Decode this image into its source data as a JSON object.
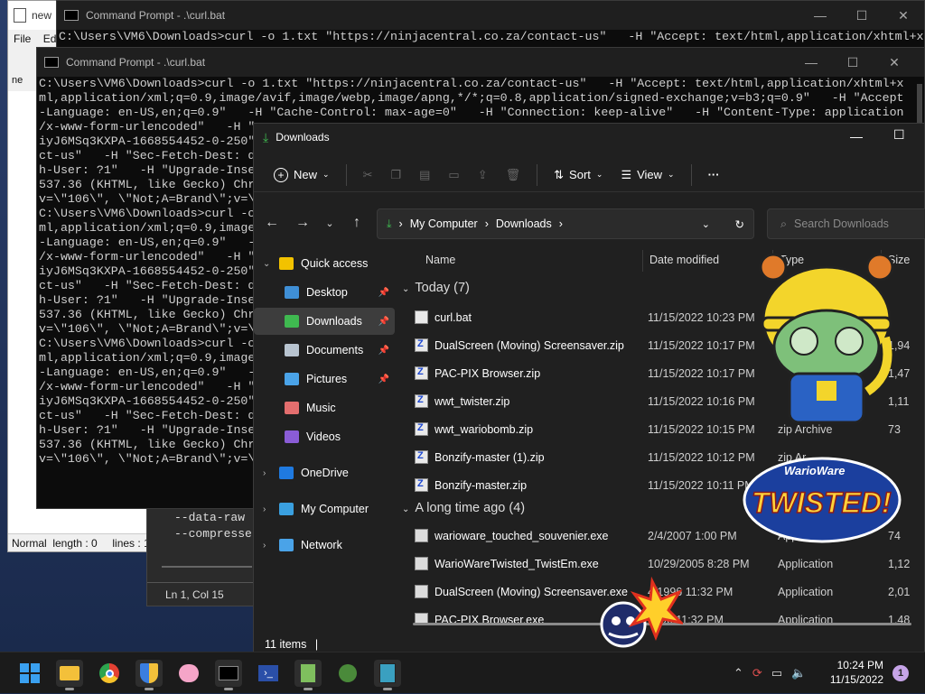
{
  "notepad": {
    "title": "new",
    "menu_file": "File",
    "menu_edit": "Ed",
    "tab": "ne",
    "status": "Normal  length : 0     lines : 1"
  },
  "editor2": {
    "lines": [
      "--data-raw",
      "--compresse"
    ],
    "status": "Ln 1, Col 15"
  },
  "cmd_back": {
    "title": "Command Prompt - .\\curl.bat",
    "lines": [
      "C:\\Users\\VM6\\Downloads>curl -o 1.txt \"https://ninjacentral.co.za/contact-us\"   -H \"Accept: text/html,application/xhtml+x"
    ]
  },
  "cmd_front": {
    "title": "Command Prompt - .\\curl.bat",
    "lines": [
      "C:\\Users\\VM6\\Downloads>curl -o 1.txt \"https://ninjacentral.co.za/contact-us\"   -H \"Accept: text/html,application/xhtml+x",
      "ml,application/xml;q=0.9,image/avif,image/webp,image/apng,*/*;q=0.8,application/signed-exchange;v=b3;q=0.9\"   -H \"Accept",
      "-Language: en-US,en;q=0.9\"   -H \"Cache-Control: max-age=0\"   -H \"Connection: keep-alive\"   -H \"Content-Type: application",
      "/x-www-form-urlencoded\"   -H \"",
      "iyJ6MSq3KXPA-1668554452-0-250\"",
      "ct-us\"   -H \"Sec-Fetch-Dest: d",
      "h-User: ?1\"   -H \"Upgrade-Inse",
      "537.36 (KHTML, like Gecko) Chr",
      "v=\\\"106\\\", \\\"Not;A=Brand\\\";v=\\",
      "",
      "C:\\Users\\VM6\\Downloads>curl -o",
      "ml,application/xml;q=0.9,image",
      "-Language: en-US,en;q=0.9\"   -H",
      "/x-www-form-urlencoded\"   -H \"",
      "iyJ6MSq3KXPA-1668554452-0-250\"",
      "ct-us\"   -H \"Sec-Fetch-Dest: d",
      "h-User: ?1\"   -H \"Upgrade-Inse",
      "537.36 (KHTML, like Gecko) Chr",
      "v=\\\"106\\\", \\\"Not;A=Brand\\\";v=\\",
      "",
      "C:\\Users\\VM6\\Downloads>curl -o",
      "ml,application/xml;q=0.9,image",
      "-Language: en-US,en;q=0.9\"   -H",
      "/x-www-form-urlencoded\"   -H \"",
      "iyJ6MSq3KXPA-1668554452-0-250\"",
      "ct-us\"   -H \"Sec-Fetch-Dest: d",
      "h-User: ?1\"   -H \"Upgrade-Inse",
      "537.36 (KHTML, like Gecko) Chr",
      "v=\\\"106\\\", \\\"Not;A=Brand\\\";v=\\"
    ]
  },
  "explorer": {
    "title": "Downloads",
    "toolbar": {
      "new": "New",
      "sort": "Sort",
      "view": "View",
      "more": "···"
    },
    "breadcrumb": [
      "My Computer",
      "Downloads"
    ],
    "search_placeholder": "Search Downloads",
    "columns": {
      "name": "Name",
      "date": "Date modified",
      "type": "Type",
      "size": "Size"
    },
    "sidebar": [
      {
        "label": "Quick access",
        "icon": "star-icon",
        "color": "#f2c200"
      },
      {
        "label": "Desktop",
        "icon": "desktop-icon",
        "color": "#3f8fd6"
      },
      {
        "label": "Downloads",
        "icon": "download-icon",
        "color": "#3fb950"
      },
      {
        "label": "Documents",
        "icon": "document-icon",
        "color": "#b8c4d0"
      },
      {
        "label": "Pictures",
        "icon": "pictures-icon",
        "color": "#4aa3e8"
      },
      {
        "label": "Music",
        "icon": "music-icon",
        "color": "#e36e6e"
      },
      {
        "label": "Videos",
        "icon": "videos-icon",
        "color": "#8a5cd6"
      },
      {
        "label": "OneDrive",
        "icon": "cloud-icon",
        "color": "#1f7ae0"
      },
      {
        "label": "My Computer",
        "icon": "computer-icon",
        "color": "#3aa0e0"
      },
      {
        "label": "Network",
        "icon": "network-icon",
        "color": "#4aa3e8"
      }
    ],
    "groups": {
      "today": "Today (7)",
      "old": "A long time ago (4)"
    },
    "rows": [
      {
        "name": "curl.bat",
        "date": "11/15/2022 10:23 PM",
        "type": "",
        "size": "",
        "kind": "bat"
      },
      {
        "name": "DualScreen (Moving) Screensaver.zip",
        "date": "11/15/2022 10:17 PM",
        "type": "",
        "size": "1,94",
        "kind": "zip"
      },
      {
        "name": "PAC-PIX Browser.zip",
        "date": "11/15/2022 10:17 PM",
        "type": "",
        "size": "1,47",
        "kind": "zip"
      },
      {
        "name": "wwt_twister.zip",
        "date": "11/15/2022 10:16 PM",
        "type": "",
        "size": "1,11",
        "kind": "zip"
      },
      {
        "name": "wwt_wariobomb.zip",
        "date": "11/15/2022 10:15 PM",
        "type": "zip Archive",
        "size": "73",
        "kind": "zip"
      },
      {
        "name": "Bonzify-master (1).zip",
        "date": "11/15/2022 10:12 PM",
        "type": "zip Ar",
        "size": "",
        "kind": "zip"
      },
      {
        "name": "Bonzify-master.zip",
        "date": "11/15/2022 10:11 PM",
        "type": "",
        "size": "",
        "kind": "zip"
      },
      {
        "name": "warioware_touched_souvenier.exe",
        "date": "2/4/2007 1:00 PM",
        "type": "App",
        "size": "74",
        "kind": "exe"
      },
      {
        "name": "WarioWareTwisted_TwistEm.exe",
        "date": "10/29/2005 8:28 PM",
        "type": "Application",
        "size": "1,12",
        "kind": "exe"
      },
      {
        "name": "DualScreen (Moving) Screensaver.exe",
        "date": "4/1996 11:32 PM",
        "type": "Application",
        "size": "2,01",
        "kind": "exe"
      },
      {
        "name": "PAC-PIX Browser.exe",
        "date": "1996 11:32 PM",
        "type": "Application",
        "size": "1,48",
        "kind": "exe"
      }
    ],
    "status": "11 items",
    "logo_text": [
      "WarioWare",
      "TWISTED!"
    ]
  },
  "taskbar": {
    "icons": [
      "windows-start-icon",
      "file-explorer-icon",
      "chrome-icon",
      "security-shield-icon",
      "kirby-icon",
      "terminal-icon",
      "powershell-icon",
      "notepad-plus-plus-icon",
      "bug-icon",
      "notepad-icon"
    ],
    "time": "10:24 PM",
    "date": "11/15/2022",
    "notifications": "1"
  }
}
